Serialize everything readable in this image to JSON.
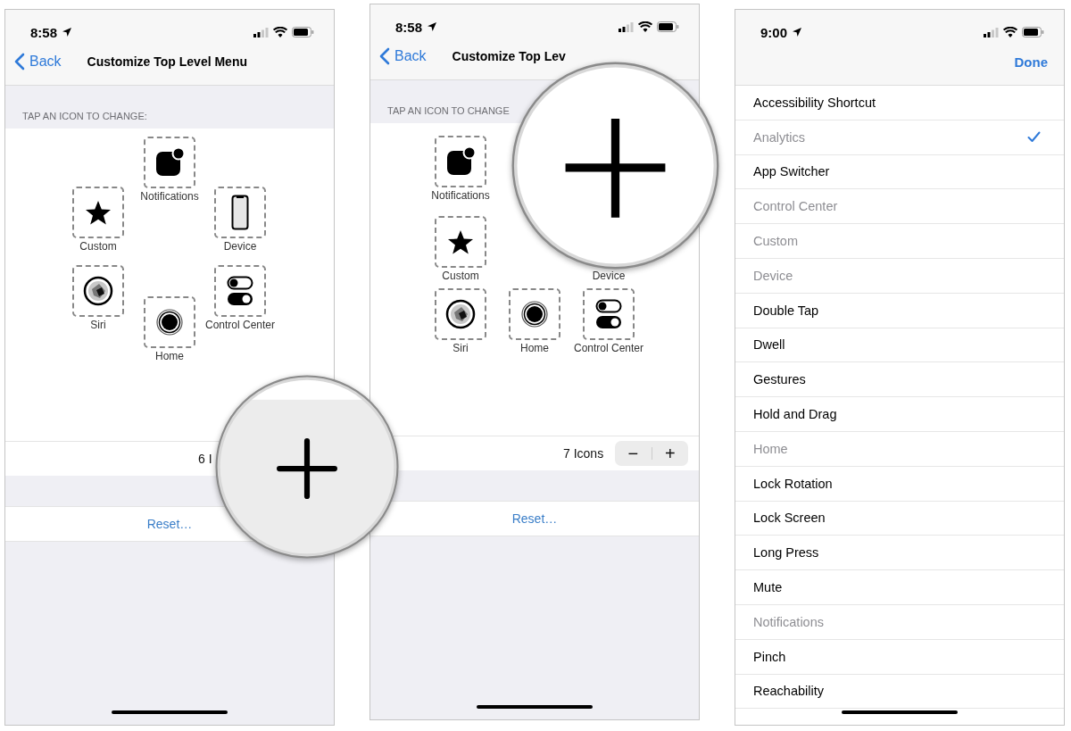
{
  "screens": [
    {
      "kind": "icon_ring",
      "status_bar": {
        "time": "8:58"
      },
      "nav": {
        "back": "Back",
        "title": "Customize Top Level Menu"
      },
      "section_header": "TAP AN ICON TO CHANGE:",
      "icons": [
        {
          "label": "Notifications",
          "kind": "notifications"
        },
        {
          "label": "Custom",
          "kind": "custom"
        },
        {
          "label": "Device",
          "kind": "device"
        },
        {
          "label": "Siri",
          "kind": "siri"
        },
        {
          "label": "Home",
          "kind": "home"
        },
        {
          "label": "Control Center",
          "kind": "control_center"
        }
      ],
      "count": "6 I",
      "reset": "Reset…",
      "magnifier": {
        "kind": "plus",
        "shaded": true
      }
    },
    {
      "kind": "icon_grid",
      "status_bar": {
        "time": "8:58"
      },
      "nav": {
        "back": "Back",
        "title": "Customize Top Lev"
      },
      "section_header": "TAP AN ICON TO CHANGE",
      "icons": [
        {
          "label": "Notifications",
          "kind": "notifications"
        },
        {
          "label": "Custom",
          "kind": "custom"
        },
        {
          "label": "Device",
          "kind": "label_only"
        },
        {
          "label": "Siri",
          "kind": "siri"
        },
        {
          "label": "Home",
          "kind": "home"
        },
        {
          "label": "Control Center",
          "kind": "control_center"
        }
      ],
      "count": "7 Icons",
      "stepper": {
        "minus": "−",
        "plus": "+"
      },
      "reset": "Reset…",
      "magnifier": {
        "kind": "plus",
        "shaded": false
      }
    },
    {
      "kind": "option_list",
      "status_bar": {
        "time": "9:00"
      },
      "nav": {
        "done": "Done"
      },
      "options": [
        {
          "label": "Accessibility Shortcut",
          "disabled": false,
          "selected": false
        },
        {
          "label": "Analytics",
          "disabled": true,
          "selected": true
        },
        {
          "label": "App Switcher",
          "disabled": false,
          "selected": false
        },
        {
          "label": "Control Center",
          "disabled": true,
          "selected": false
        },
        {
          "label": "Custom",
          "disabled": true,
          "selected": false
        },
        {
          "label": "Device",
          "disabled": true,
          "selected": false
        },
        {
          "label": "Double Tap",
          "disabled": false,
          "selected": false
        },
        {
          "label": "Dwell",
          "disabled": false,
          "selected": false
        },
        {
          "label": "Gestures",
          "disabled": false,
          "selected": false
        },
        {
          "label": "Hold and Drag",
          "disabled": false,
          "selected": false
        },
        {
          "label": "Home",
          "disabled": true,
          "selected": false
        },
        {
          "label": "Lock Rotation",
          "disabled": false,
          "selected": false
        },
        {
          "label": "Lock Screen",
          "disabled": false,
          "selected": false
        },
        {
          "label": "Long Press",
          "disabled": false,
          "selected": false
        },
        {
          "label": "Mute",
          "disabled": false,
          "selected": false
        },
        {
          "label": "Notifications",
          "disabled": true,
          "selected": false
        },
        {
          "label": "Pinch",
          "disabled": false,
          "selected": false
        },
        {
          "label": "Reachability",
          "disabled": false,
          "selected": false
        }
      ]
    }
  ]
}
